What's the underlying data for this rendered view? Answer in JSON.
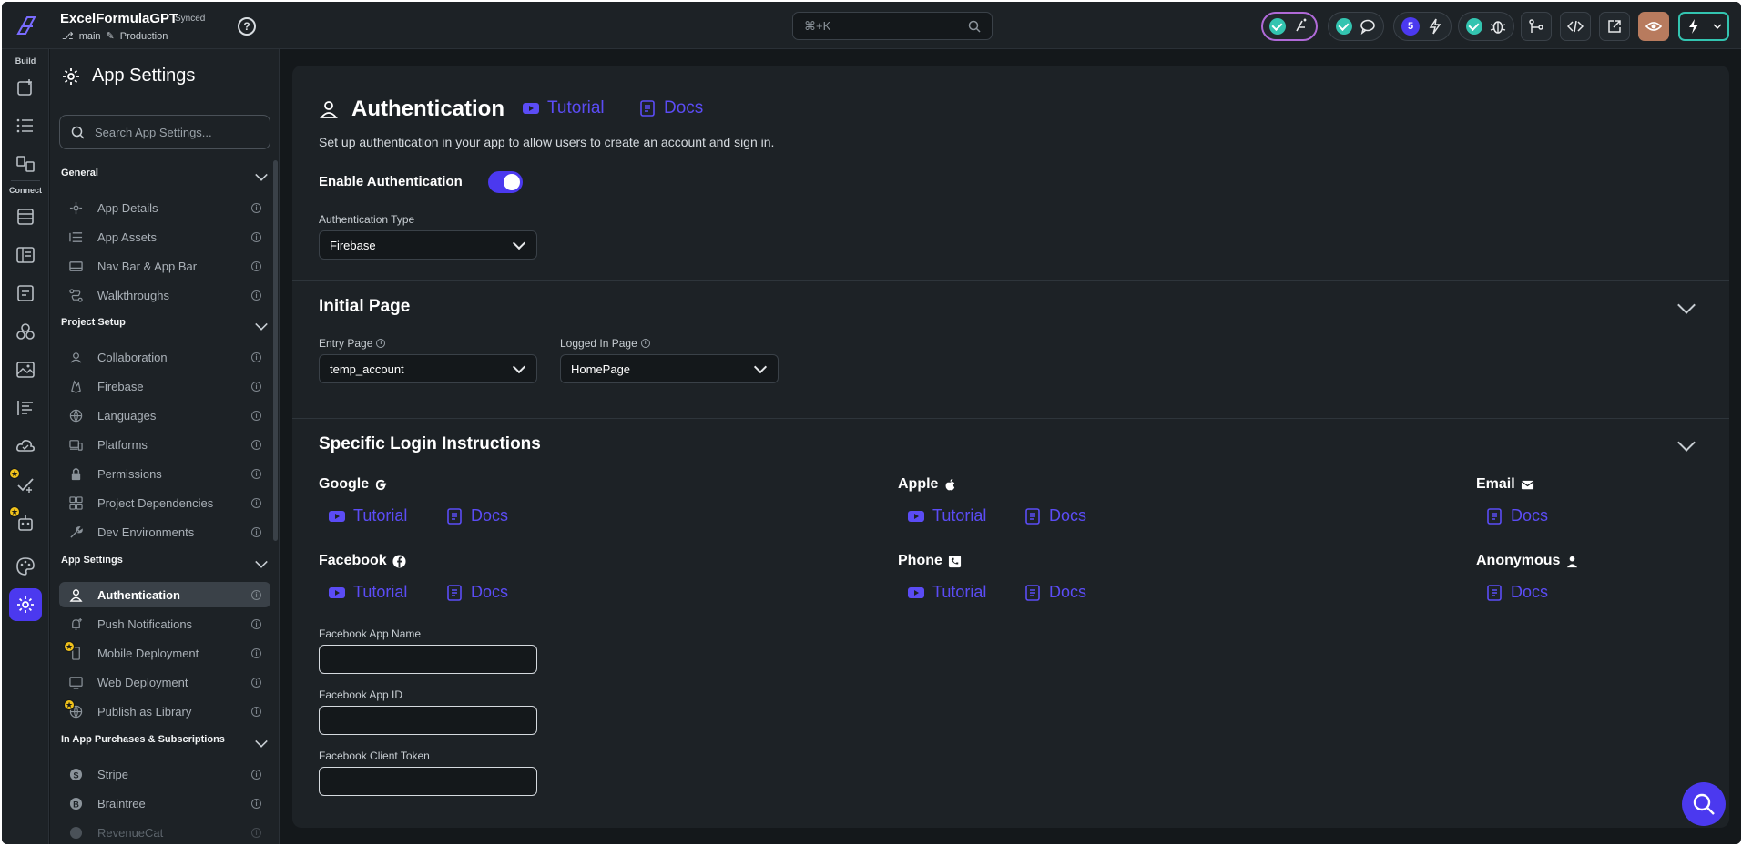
{
  "topbar": {
    "project_name": "ExcelFormulaGPT",
    "sync_status": "Synced",
    "branch": "main",
    "environment": "Production",
    "help_label": "?",
    "search_shortcut": "⌘+K",
    "issues_count": "5"
  },
  "rail": {
    "build_label": "Build",
    "connect_label": "Connect"
  },
  "nav": {
    "title": "App Settings",
    "search_placeholder": "Search App Settings...",
    "sections": [
      {
        "title": "General",
        "items": [
          "App Details",
          "App Assets",
          "Nav Bar & App Bar",
          "Walkthroughs"
        ]
      },
      {
        "title": "Project Setup",
        "items": [
          "Collaboration",
          "Firebase",
          "Languages",
          "Platforms",
          "Permissions",
          "Project Dependencies",
          "Dev Environments"
        ]
      },
      {
        "title": "App Settings",
        "items": [
          "Authentication",
          "Push Notifications",
          "Mobile Deployment",
          "Web Deployment",
          "Publish as Library"
        ]
      },
      {
        "title": "In App Purchases & Subscriptions",
        "items": [
          "Stripe",
          "Braintree",
          "RevenueCat"
        ]
      }
    ],
    "active_item": "Authentication"
  },
  "auth": {
    "title": "Authentication",
    "tutorial_label": "Tutorial",
    "docs_label": "Docs",
    "description": "Set up authentication in your app to allow users to create an account and sign in.",
    "enable_label": "Enable Authentication",
    "enabled": true,
    "type_label": "Authentication Type",
    "type_value": "Firebase"
  },
  "initial_page": {
    "title": "Initial Page",
    "entry_label": "Entry Page",
    "entry_value": "temp_account",
    "logged_in_label": "Logged In Page",
    "logged_in_value": "HomePage"
  },
  "login": {
    "title": "Specific Login Instructions",
    "providers": {
      "google": "Google",
      "apple": "Apple",
      "email": "Email",
      "facebook": "Facebook",
      "phone": "Phone",
      "anonymous": "Anonymous"
    },
    "tutorial_label": "Tutorial",
    "docs_label": "Docs",
    "fb_app_name_label": "Facebook App Name",
    "fb_app_id_label": "Facebook App ID",
    "fb_client_token_label": "Facebook Client Token",
    "fb_app_name_value": "",
    "fb_app_id_value": "",
    "fb_client_token_value": ""
  },
  "colors": {
    "accent": "#4b39ef",
    "link": "#5b4cf5",
    "success": "#33c4b0",
    "background": "#14181b",
    "surface": "#1d2226"
  },
  "icons": [
    "search-icon",
    "gear-icon",
    "youtube-icon",
    "docs-icon",
    "user-icon",
    "google-icon",
    "apple-icon",
    "mail-icon",
    "facebook-icon",
    "phone-icon",
    "chevron-down-icon",
    "info-icon"
  ]
}
